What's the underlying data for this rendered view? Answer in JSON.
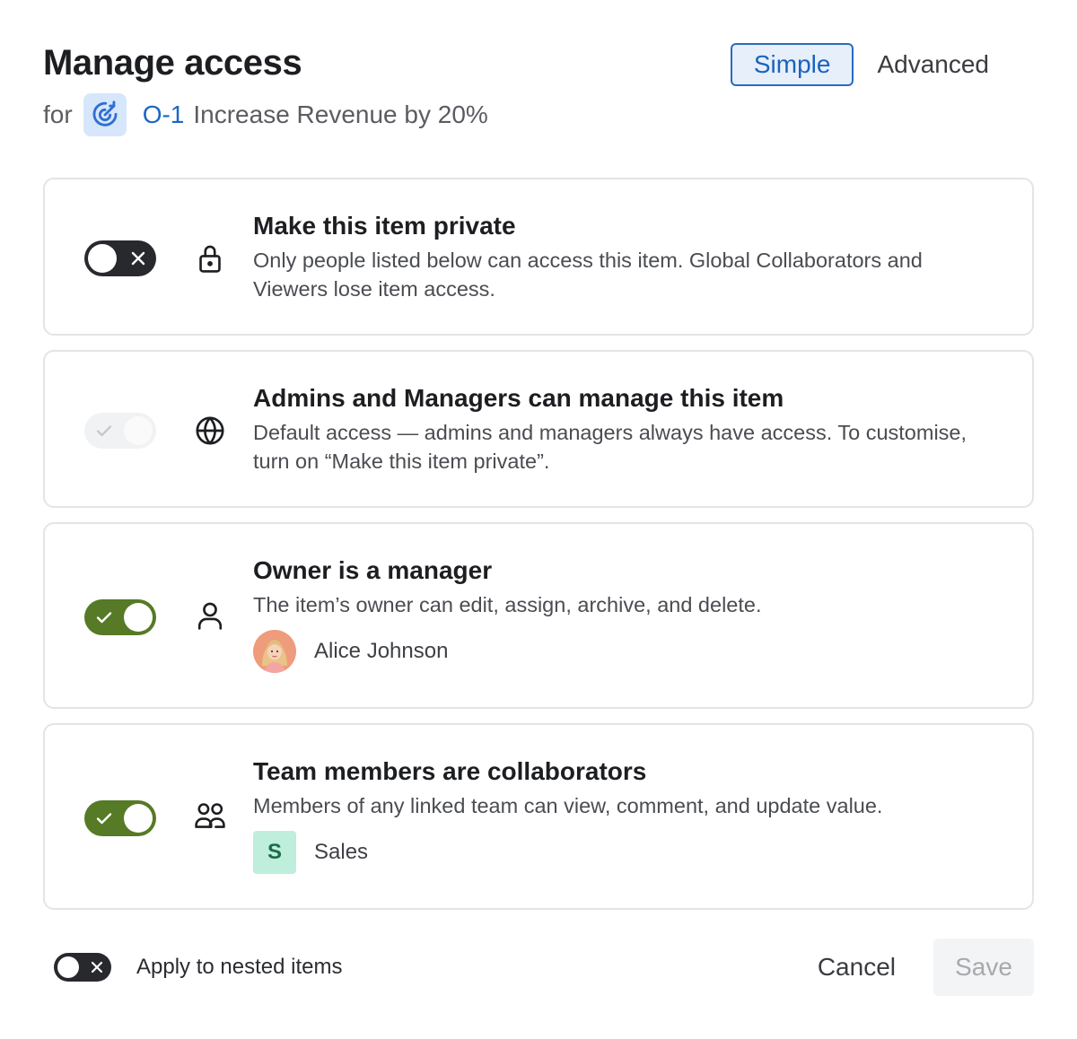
{
  "header": {
    "title": "Manage access",
    "for_label": "for",
    "item_icon": "target-arrow-icon",
    "item_code": "O-1",
    "item_name": "Increase Revenue by 20%",
    "view_modes": [
      {
        "label": "Simple",
        "active": true
      },
      {
        "label": "Advanced",
        "active": false
      }
    ]
  },
  "cards": [
    {
      "title": "Make this item private",
      "description": "Only people listed below can access this item. Global Collaborators and Viewers lose item access.",
      "icon": "lock-icon",
      "toggle_state": "off"
    },
    {
      "title": "Admins and Managers can manage this item",
      "description": "Default access — admins and managers always have access. To customise, turn on “Make this item private”.",
      "icon": "globe-icon",
      "toggle_state": "on-disabled"
    },
    {
      "title": "Owner is a manager",
      "description": "The item’s owner can edit, assign, archive, and delete.",
      "icon": "person-icon",
      "toggle_state": "on",
      "person_name": "Alice Johnson"
    },
    {
      "title": "Team members are collaborators",
      "description": "Members of any linked team can view, comment, and update value.",
      "icon": "people-icon",
      "toggle_state": "on",
      "team_initial": "S",
      "team_name": "Sales"
    }
  ],
  "footer": {
    "nested_label": "Apply to nested items",
    "nested_toggle_state": "off",
    "cancel_label": "Cancel",
    "save_label": "Save"
  },
  "colors": {
    "toggle_on": "#567a25",
    "toggle_off": "#27292d",
    "accent_blue": "#1a63be",
    "team_badge_bg": "#bfeedd"
  }
}
